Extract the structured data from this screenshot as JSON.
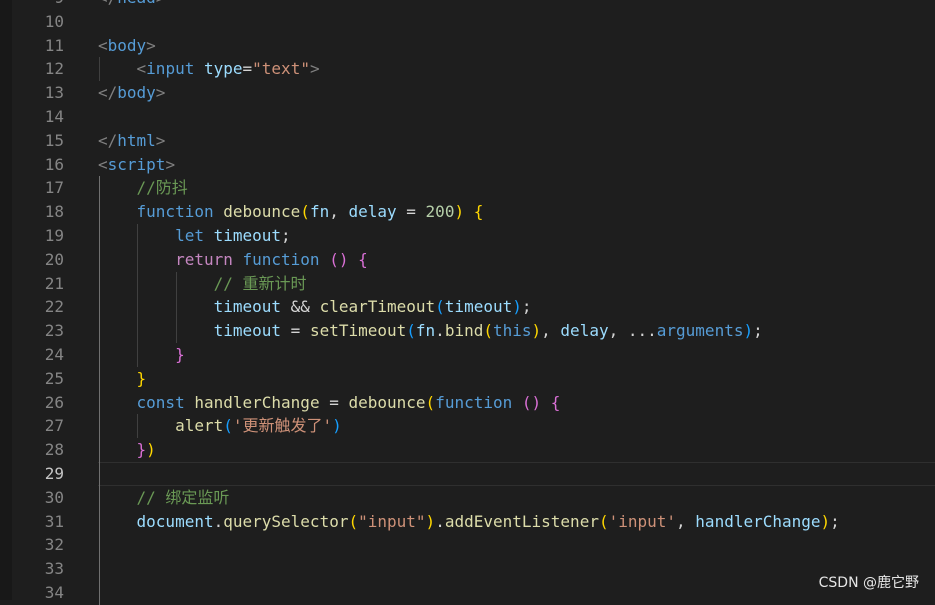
{
  "editor": {
    "lines": [
      {
        "n": "9",
        "tokens": [
          [
            "tok-punct",
            "</"
          ],
          [
            "tok-tag",
            "head"
          ],
          [
            "tok-punct",
            ">"
          ]
        ]
      },
      {
        "n": "10",
        "tokens": []
      },
      {
        "n": "11",
        "tokens": [
          [
            "tok-punct",
            "<"
          ],
          [
            "tok-tag",
            "body"
          ],
          [
            "tok-punct",
            ">"
          ]
        ]
      },
      {
        "n": "12",
        "tokens": [
          [
            "tok-op",
            "    "
          ],
          [
            "tok-punct",
            "<"
          ],
          [
            "tok-tag",
            "input"
          ],
          [
            "tok-op",
            " "
          ],
          [
            "tok-attr",
            "type"
          ],
          [
            "tok-op",
            "="
          ],
          [
            "tok-str",
            "\"text\""
          ],
          [
            "tok-punct",
            ">"
          ]
        ]
      },
      {
        "n": "13",
        "tokens": [
          [
            "tok-punct",
            "</"
          ],
          [
            "tok-tag",
            "body"
          ],
          [
            "tok-punct",
            ">"
          ]
        ]
      },
      {
        "n": "14",
        "tokens": []
      },
      {
        "n": "15",
        "tokens": [
          [
            "tok-punct",
            "</"
          ],
          [
            "tok-tag",
            "html"
          ],
          [
            "tok-punct",
            ">"
          ]
        ]
      },
      {
        "n": "16",
        "tokens": [
          [
            "tok-punct",
            "<"
          ],
          [
            "tok-tag",
            "script"
          ],
          [
            "tok-punct",
            ">"
          ]
        ]
      },
      {
        "n": "17",
        "tokens": [
          [
            "tok-op",
            "    "
          ],
          [
            "tok-cmt",
            "//防抖"
          ]
        ]
      },
      {
        "n": "18",
        "tokens": [
          [
            "tok-op",
            "    "
          ],
          [
            "tok-kw",
            "function"
          ],
          [
            "tok-op",
            " "
          ],
          [
            "tok-fn",
            "debounce"
          ],
          [
            "b1",
            "("
          ],
          [
            "tok-var",
            "fn"
          ],
          [
            "tok-op",
            ", "
          ],
          [
            "tok-var",
            "delay"
          ],
          [
            "tok-op",
            " = "
          ],
          [
            "tok-num",
            "200"
          ],
          [
            "b1",
            ")"
          ],
          [
            "tok-op",
            " "
          ],
          [
            "b1",
            "{"
          ]
        ]
      },
      {
        "n": "19",
        "tokens": [
          [
            "tok-op",
            "        "
          ],
          [
            "tok-kw",
            "let"
          ],
          [
            "tok-op",
            " "
          ],
          [
            "tok-var",
            "timeout"
          ],
          [
            "tok-op",
            ";"
          ]
        ]
      },
      {
        "n": "20",
        "tokens": [
          [
            "tok-op",
            "        "
          ],
          [
            "tok-ctrl",
            "return"
          ],
          [
            "tok-op",
            " "
          ],
          [
            "tok-kw",
            "function"
          ],
          [
            "tok-op",
            " "
          ],
          [
            "b2",
            "()"
          ],
          [
            "tok-op",
            " "
          ],
          [
            "b2",
            "{"
          ]
        ]
      },
      {
        "n": "21",
        "tokens": [
          [
            "tok-op",
            "            "
          ],
          [
            "tok-cmt",
            "// 重新计时"
          ]
        ]
      },
      {
        "n": "22",
        "tokens": [
          [
            "tok-op",
            "            "
          ],
          [
            "tok-var",
            "timeout"
          ],
          [
            "tok-op",
            " && "
          ],
          [
            "tok-fn",
            "clearTimeout"
          ],
          [
            "b3",
            "("
          ],
          [
            "tok-var",
            "timeout"
          ],
          [
            "b3",
            ")"
          ],
          [
            "tok-op",
            ";"
          ]
        ]
      },
      {
        "n": "23",
        "tokens": [
          [
            "tok-op",
            "            "
          ],
          [
            "tok-var",
            "timeout"
          ],
          [
            "tok-op",
            " = "
          ],
          [
            "tok-fn",
            "setTimeout"
          ],
          [
            "b3",
            "("
          ],
          [
            "tok-var",
            "fn"
          ],
          [
            "tok-op",
            "."
          ],
          [
            "tok-fn",
            "bind"
          ],
          [
            "b1",
            "("
          ],
          [
            "tok-kw",
            "this"
          ],
          [
            "b1",
            ")"
          ],
          [
            "tok-op",
            ", "
          ],
          [
            "tok-var",
            "delay"
          ],
          [
            "tok-op",
            ", ..."
          ],
          [
            "tok-kw",
            "arguments"
          ],
          [
            "b3",
            ")"
          ],
          [
            "tok-op",
            ";"
          ]
        ]
      },
      {
        "n": "24",
        "tokens": [
          [
            "tok-op",
            "        "
          ],
          [
            "b2",
            "}"
          ]
        ]
      },
      {
        "n": "25",
        "tokens": [
          [
            "tok-op",
            "    "
          ],
          [
            "b1",
            "}"
          ]
        ]
      },
      {
        "n": "26",
        "tokens": [
          [
            "tok-op",
            "    "
          ],
          [
            "tok-kw",
            "const"
          ],
          [
            "tok-op",
            " "
          ],
          [
            "tok-fn",
            "handlerChange"
          ],
          [
            "tok-op",
            " = "
          ],
          [
            "tok-fn",
            "debounce"
          ],
          [
            "b1",
            "("
          ],
          [
            "tok-kw",
            "function"
          ],
          [
            "tok-op",
            " "
          ],
          [
            "b2",
            "()"
          ],
          [
            "tok-op",
            " "
          ],
          [
            "b2",
            "{"
          ]
        ]
      },
      {
        "n": "27",
        "tokens": [
          [
            "tok-op",
            "        "
          ],
          [
            "tok-fn",
            "alert"
          ],
          [
            "b3",
            "("
          ],
          [
            "tok-str",
            "'更新触发了'"
          ],
          [
            "b3",
            ")"
          ]
        ]
      },
      {
        "n": "28",
        "tokens": [
          [
            "tok-op",
            "    "
          ],
          [
            "b2",
            "}"
          ],
          [
            "b1",
            ")"
          ]
        ]
      },
      {
        "n": "29",
        "tokens": [],
        "current": true
      },
      {
        "n": "30",
        "tokens": [
          [
            "tok-op",
            "    "
          ],
          [
            "tok-cmt",
            "// 绑定监听"
          ]
        ]
      },
      {
        "n": "31",
        "tokens": [
          [
            "tok-op",
            "    "
          ],
          [
            "tok-var",
            "document"
          ],
          [
            "tok-op",
            "."
          ],
          [
            "tok-fn",
            "querySelector"
          ],
          [
            "b1",
            "("
          ],
          [
            "tok-str",
            "\"input\""
          ],
          [
            "b1",
            ")"
          ],
          [
            "tok-op",
            "."
          ],
          [
            "tok-fn",
            "addEventListener"
          ],
          [
            "b1",
            "("
          ],
          [
            "tok-str",
            "'input'"
          ],
          [
            "tok-op",
            ", "
          ],
          [
            "tok-var",
            "handlerChange"
          ],
          [
            "b1",
            ")"
          ],
          [
            "tok-op",
            ";"
          ]
        ]
      },
      {
        "n": "32",
        "tokens": []
      },
      {
        "n": "33",
        "tokens": []
      },
      {
        "n": "34",
        "tokens": []
      }
    ]
  },
  "watermark": "CSDN @鹿它野"
}
